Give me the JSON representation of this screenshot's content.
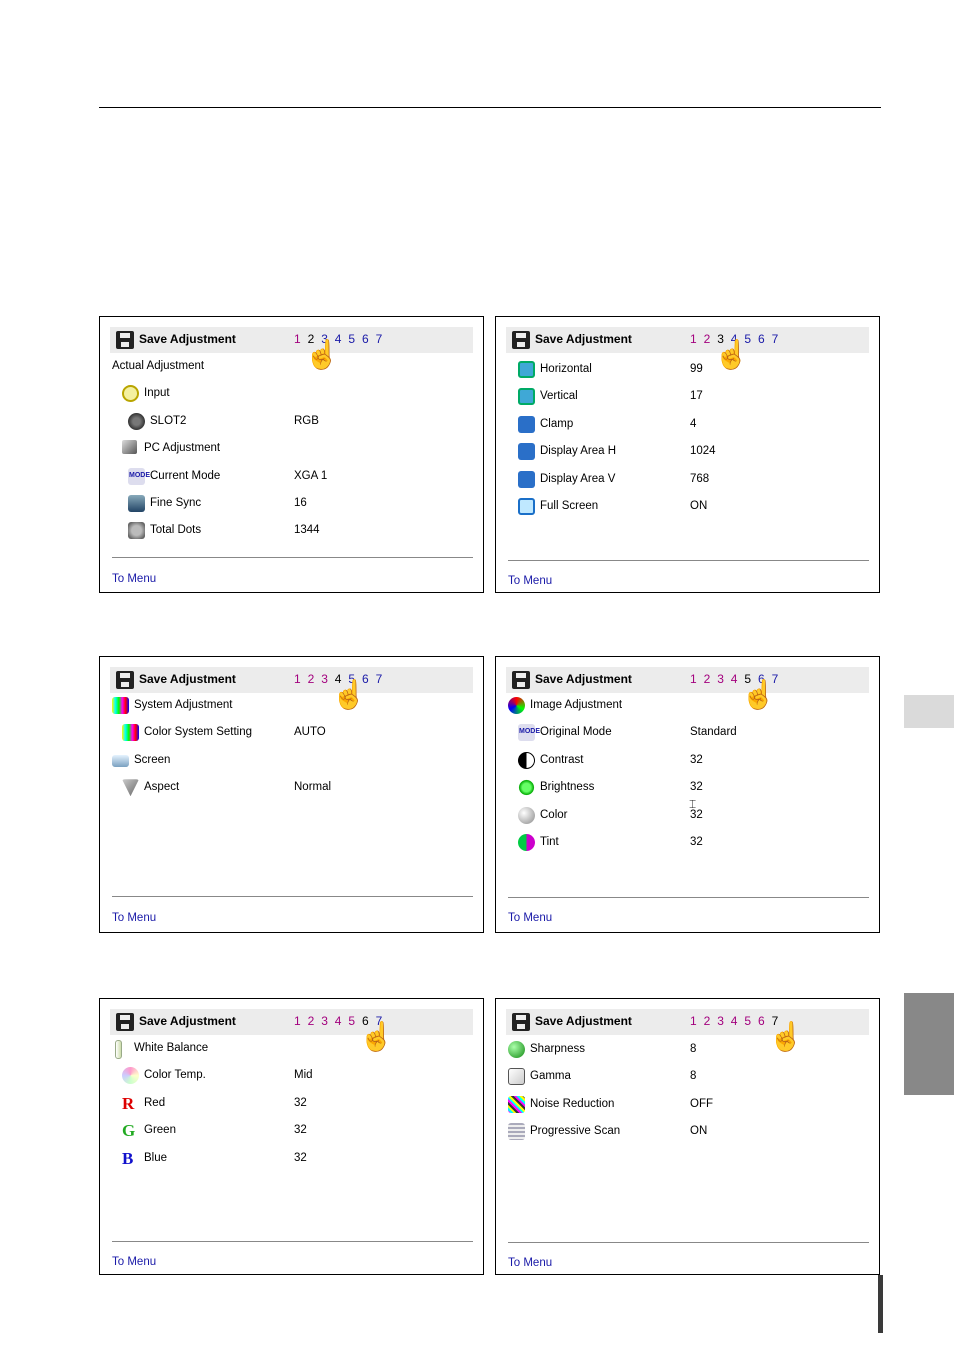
{
  "panels": [
    {
      "header_label": "Save Adjustment",
      "pages": [
        "1",
        "2",
        "3",
        "4",
        "5",
        "6",
        "7"
      ],
      "active_page": 2,
      "rows": [
        {
          "label": "Actual Adjustment",
          "value": "",
          "icon": "none-icon",
          "indent": 0
        },
        {
          "label": "Input",
          "value": "",
          "icon": "power-icon",
          "indent": 1
        },
        {
          "label": "SLOT2",
          "value": "RGB",
          "icon": "slot-connector-icon",
          "indent": 2
        },
        {
          "label": "PC Adjustment",
          "value": "",
          "icon": "pc-icon",
          "indent": 1
        },
        {
          "label": "Current Mode",
          "value": "XGA 1",
          "icon": "mode-icon",
          "indent": 2
        },
        {
          "label": "Fine Sync",
          "value": "16",
          "icon": "fine-sync-icon",
          "indent": 2
        },
        {
          "label": "Total Dots",
          "value": "1344",
          "icon": "total-dots-icon",
          "indent": 2
        }
      ],
      "footer_link": "To Menu"
    },
    {
      "header_label": "Save Adjustment",
      "pages": [
        "1",
        "2",
        "3",
        "4",
        "5",
        "6",
        "7"
      ],
      "active_page": 3,
      "rows": [
        {
          "label": "Horizontal",
          "value": "99",
          "icon": "horizontal-position-icon",
          "indent": 1
        },
        {
          "label": "Vertical",
          "value": "17",
          "icon": "vertical-position-icon",
          "indent": 1
        },
        {
          "label": "Clamp",
          "value": "4",
          "icon": "clamp-icon",
          "indent": 1
        },
        {
          "label": "Display Area H",
          "value": "1024",
          "icon": "display-area-h-icon",
          "indent": 1
        },
        {
          "label": "Display Area V",
          "value": "768",
          "icon": "display-area-v-icon",
          "indent": 1
        },
        {
          "label": "Full Screen",
          "value": "ON",
          "icon": "full-screen-icon",
          "indent": 1
        }
      ],
      "footer_link": "To Menu"
    },
    {
      "header_label": "Save Adjustment",
      "pages": [
        "1",
        "2",
        "3",
        "4",
        "5",
        "6",
        "7"
      ],
      "active_page": 4,
      "rows": [
        {
          "label": "System Adjustment",
          "value": "",
          "icon": "color-bars-icon",
          "indent": 0
        },
        {
          "label": "Color System Setting",
          "value": "AUTO",
          "icon": "color-bars-icon",
          "indent": 1
        },
        {
          "label": "Screen",
          "value": "",
          "icon": "screen-icon",
          "indent": 0
        },
        {
          "label": "Aspect",
          "value": "Normal",
          "icon": "aspect-icon",
          "indent": 1
        }
      ],
      "footer_link": "To Menu"
    },
    {
      "header_label": "Save Adjustment",
      "pages": [
        "1",
        "2",
        "3",
        "4",
        "5",
        "6",
        "7"
      ],
      "active_page": 5,
      "rows": [
        {
          "label": "Image Adjustment",
          "value": "",
          "icon": "rgb-circles-icon",
          "indent": 0
        },
        {
          "label": "Original Mode",
          "value": "Standard",
          "icon": "mode-icon",
          "indent": 1
        },
        {
          "label": "Contrast",
          "value": "32",
          "icon": "contrast-icon",
          "indent": 1
        },
        {
          "label": "Brightness",
          "value": "32",
          "icon": "brightness-icon",
          "indent": 1
        },
        {
          "label": "Color",
          "value": "32",
          "icon": "color-sphere-icon",
          "indent": 1
        },
        {
          "label": "Tint",
          "value": "32",
          "icon": "tint-icon",
          "indent": 1
        }
      ],
      "footer_link": "To Menu"
    },
    {
      "header_label": "Save Adjustment",
      "pages": [
        "1",
        "2",
        "3",
        "4",
        "5",
        "6",
        "7"
      ],
      "active_page": 6,
      "rows": [
        {
          "label": "White Balance",
          "value": "",
          "icon": "white-balance-icon",
          "indent": 0
        },
        {
          "label": "Color Temp.",
          "value": "Mid",
          "icon": "color-wheel-icon",
          "indent": 1
        },
        {
          "label": "Red",
          "value": "32",
          "icon": "red-r-icon",
          "indent": 1
        },
        {
          "label": "Green",
          "value": "32",
          "icon": "green-g-icon",
          "indent": 1
        },
        {
          "label": "Blue",
          "value": "32",
          "icon": "blue-b-icon",
          "indent": 1
        }
      ],
      "footer_link": "To Menu"
    },
    {
      "header_label": "Save Adjustment",
      "pages": [
        "1",
        "2",
        "3",
        "4",
        "5",
        "6",
        "7"
      ],
      "active_page": 7,
      "rows": [
        {
          "label": "Sharpness",
          "value": "8",
          "icon": "sharpness-icon",
          "indent": 0
        },
        {
          "label": "Gamma",
          "value": "8",
          "icon": "gamma-icon",
          "indent": 0
        },
        {
          "label": "Noise Reduction",
          "value": "OFF",
          "icon": "noise-reduction-icon",
          "indent": 0
        },
        {
          "label": "Progressive Scan",
          "value": "ON",
          "icon": "progressive-scan-icon",
          "indent": 0
        }
      ],
      "footer_link": "To Menu"
    }
  ],
  "colors": {
    "link": "#1a1aa8",
    "page_before": "#a3007e",
    "header_bg": "#ececec"
  }
}
